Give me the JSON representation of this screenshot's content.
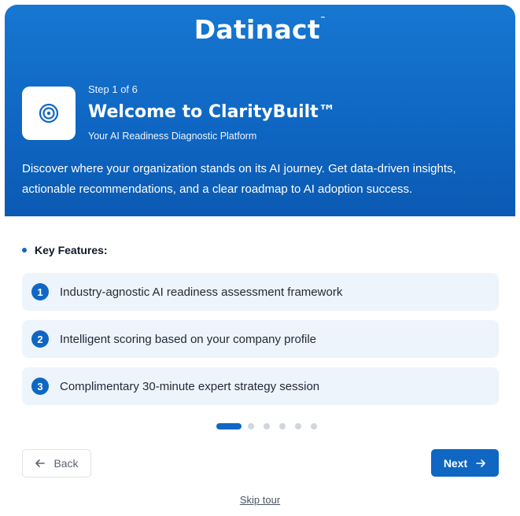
{
  "header": {
    "brand": "Datinact",
    "brand_tm": "™",
    "step": "Step 1 of 6",
    "title": "Welcome to ClarityBuilt™",
    "subtitle": "Your AI Readiness Diagnostic Platform",
    "description": "Discover where your organization stands on its AI journey. Get data-driven insights, actionable recommendations, and a clear roadmap to AI adoption success.",
    "icon": "target-icon"
  },
  "features": {
    "heading": "Key Features:",
    "items": [
      {
        "num": "1",
        "text": "Industry-agnostic AI readiness assessment framework"
      },
      {
        "num": "2",
        "text": "Intelligent scoring based on your company profile"
      },
      {
        "num": "3",
        "text": "Complimentary 30-minute expert strategy session"
      }
    ]
  },
  "progress": {
    "current": 1,
    "total": 6
  },
  "nav": {
    "back_label": "Back",
    "next_label": "Next",
    "skip_label": "Skip tour"
  },
  "colors": {
    "primary": "#0f67c3",
    "feature_bg": "#eef4fc"
  }
}
